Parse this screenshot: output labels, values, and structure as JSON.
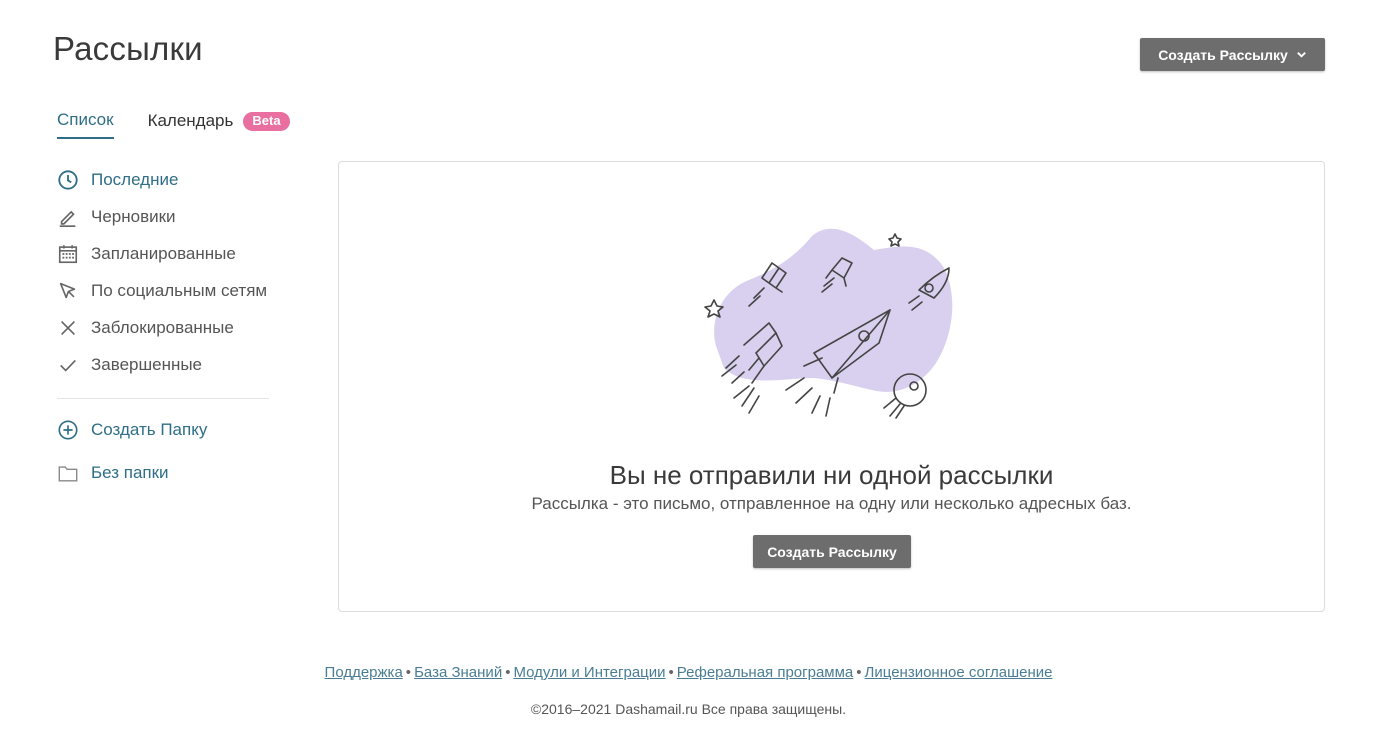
{
  "page": {
    "title": "Рассылки"
  },
  "header": {
    "create_button_label": "Создать Рассылку"
  },
  "tabs": [
    {
      "label": "Список"
    },
    {
      "label": "Календарь",
      "badge": "Beta"
    }
  ],
  "sidebar": {
    "items": [
      {
        "label": "Последние",
        "icon": "clock-icon"
      },
      {
        "label": "Черновики",
        "icon": "pencil-icon"
      },
      {
        "label": "Запланированные",
        "icon": "calendar-icon"
      },
      {
        "label": "По социальным сетям",
        "icon": "cursor-icon"
      },
      {
        "label": "Заблокированные",
        "icon": "close-icon"
      },
      {
        "label": "Завершенные",
        "icon": "check-icon"
      }
    ],
    "create_folder_label": "Создать Папку",
    "no_folder_label": "Без папки"
  },
  "empty_state": {
    "title": "Вы не отправили ни одной рассылки",
    "subtitle": "Рассылка - это письмо, отправленное на одну или несколько адресных баз.",
    "button_label": "Создать Рассылку"
  },
  "footer": {
    "links": [
      "Поддержка",
      "База Знаний",
      "Модули и Интеграции",
      "Реферальная программа",
      "Лицензионное соглашение"
    ],
    "separator": "•",
    "copyright": "©2016–2021 Dashamail.ru Все права защищены."
  },
  "colors": {
    "accent": "#2f6e86",
    "button": "#6d6d6d",
    "badge": "#e86f9f",
    "blob": "#d9d0ef"
  }
}
